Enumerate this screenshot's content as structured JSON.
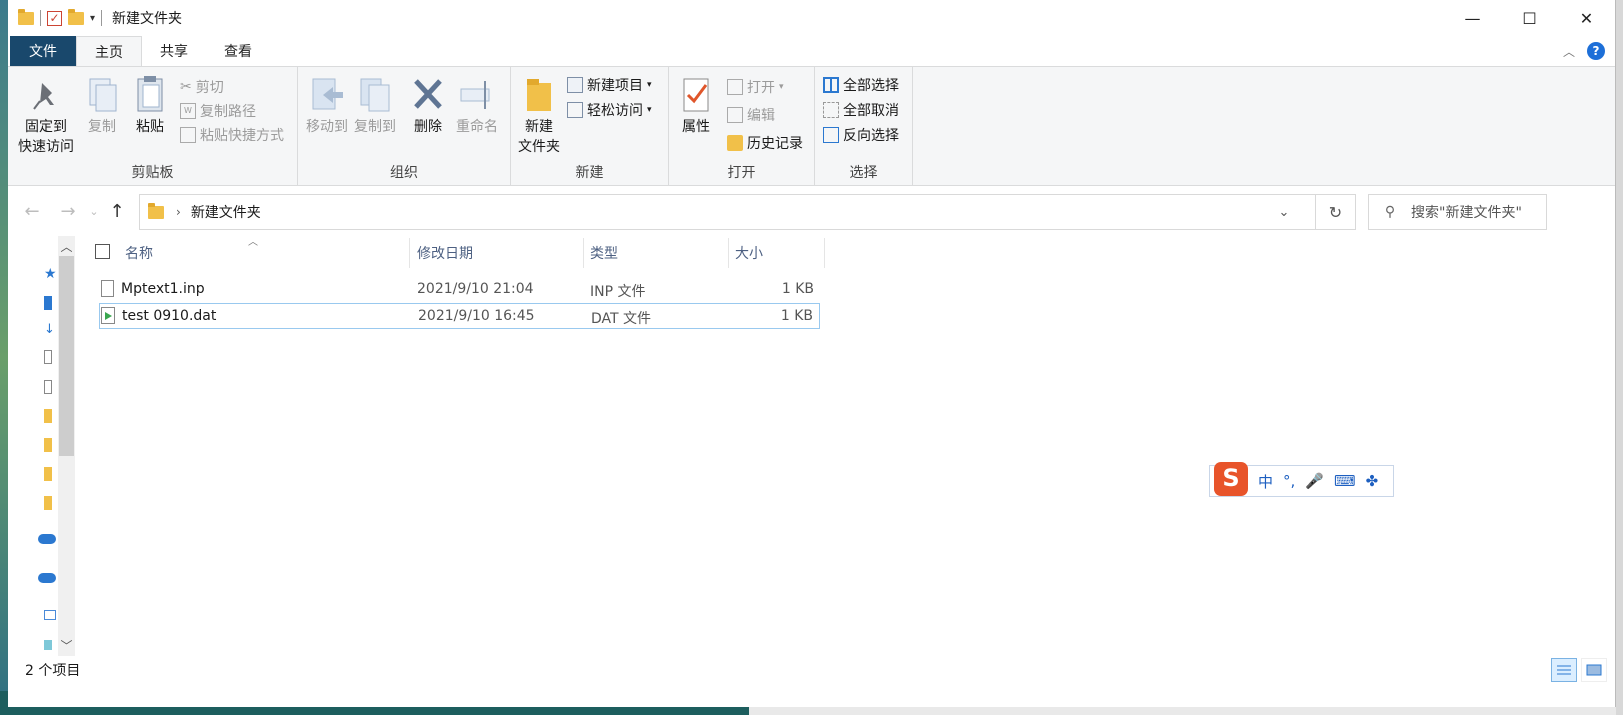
{
  "window": {
    "title": "新建文件夹",
    "controls": {
      "minimize": "—",
      "maximize": "☐",
      "close": "✕"
    }
  },
  "ribbon_tabs": [
    {
      "label": "文件"
    },
    {
      "label": "主页"
    },
    {
      "label": "共享"
    },
    {
      "label": "查看"
    }
  ],
  "ribbon": {
    "clipboard": {
      "pin": "固定到\n快速访问",
      "pin_line1": "固定到",
      "pin_line2": "快速访问",
      "copy": "复制",
      "paste": "粘贴",
      "cut": "剪切",
      "copy_path": "复制路径",
      "paste_shortcut": "粘贴快捷方式",
      "label": "剪贴板"
    },
    "organize": {
      "move_to": "移动到",
      "copy_to": "复制到",
      "delete": "删除",
      "rename": "重命名",
      "label": "组织"
    },
    "new": {
      "new_folder_line1": "新建",
      "new_folder_line2": "文件夹",
      "new_item": "新建项目",
      "easy_access": "轻松访问",
      "label": "新建"
    },
    "open": {
      "properties": "属性",
      "open": "打开",
      "edit": "编辑",
      "history": "历史记录",
      "label": "打开"
    },
    "select": {
      "select_all": "全部选择",
      "select_none": "全部取消",
      "invert": "反向选择",
      "label": "选择"
    }
  },
  "address": {
    "path": "新建文件夹",
    "search_placeholder": "搜索\"新建文件夹\""
  },
  "columns": {
    "name": "名称",
    "modified": "修改日期",
    "type": "类型",
    "size": "大小"
  },
  "files": [
    {
      "name": "Mptext1.inp",
      "modified": "2021/9/10 21:04",
      "type": "INP 文件",
      "size": "1 KB"
    },
    {
      "name": "test 0910.dat",
      "modified": "2021/9/10 16:45",
      "type": "DAT 文件",
      "size": "1 KB"
    }
  ],
  "ime": {
    "logo": "S",
    "mode": "中",
    "punct": "°,",
    "mic": "🎤",
    "keyboard": "⌨",
    "menu": "✤"
  },
  "status": {
    "count": "2 个项目"
  },
  "colors": {
    "file_tab": "#19486c",
    "accent": "#1d6fd8",
    "selection_border": "#99c9ef"
  }
}
